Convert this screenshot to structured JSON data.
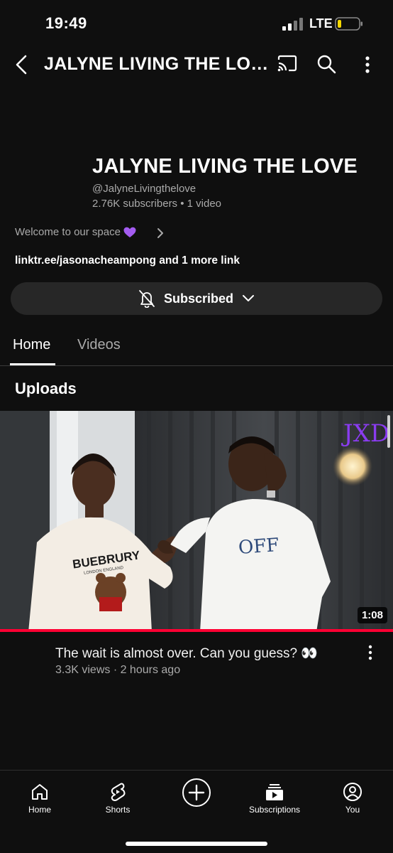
{
  "status_bar": {
    "time": "19:49",
    "network": "LTE"
  },
  "header": {
    "title": "JALYNE LIVING THE LOVE"
  },
  "channel": {
    "name": "JALYNE LIVING THE LOVE",
    "handle": "@JalyneLivingthelove",
    "stats": "2.76K subscribers • 1 video",
    "description": "Welcome to our space",
    "links": "linktr.ee/jasonacheampong and 1 more link"
  },
  "subscribe": {
    "label": "Subscribed"
  },
  "tabs": [
    {
      "label": "Home",
      "active": true
    },
    {
      "label": "Videos",
      "active": false
    }
  ],
  "section": {
    "title": "Uploads"
  },
  "video": {
    "title": "The wait is almost over. Can you guess? 👀",
    "meta": "3.3K views · 2 hours ago",
    "duration": "1:08",
    "watermark": "JXD",
    "shirt_text_left": "BUEBRURY",
    "shirt_subtext_left": "LONDON ENGLAND",
    "shirt_text_right": "OFF"
  },
  "bottom_nav": [
    {
      "label": "Home",
      "icon": "home-icon"
    },
    {
      "label": "Shorts",
      "icon": "shorts-icon"
    },
    {
      "label": "",
      "icon": "create-icon"
    },
    {
      "label": "Subscriptions",
      "icon": "subscriptions-icon"
    },
    {
      "label": "You",
      "icon": "you-icon"
    }
  ],
  "colors": {
    "background": "#0f0f0f",
    "accent": "#ff0033",
    "button": "#272727",
    "secondary_text": "#aaaaaa",
    "heart": "#a35cf0"
  }
}
